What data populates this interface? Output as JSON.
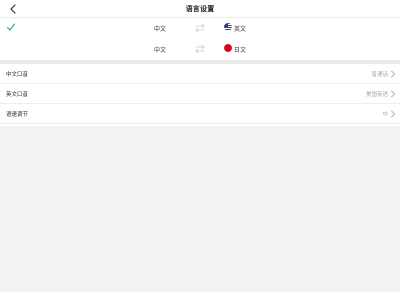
{
  "header": {
    "title": "语言设置",
    "back_icon": "chevron-left-icon"
  },
  "language_pairs": [
    {
      "source": "中文",
      "target": "英文",
      "target_flag": "us-flag-icon",
      "selected": true
    },
    {
      "source": "中文",
      "target": "日文",
      "target_flag": "jp-flag-icon",
      "selected": false
    }
  ],
  "settings": [
    {
      "label": "中文口音",
      "value": "普通话"
    },
    {
      "label": "英文口音",
      "value": "美国英语"
    },
    {
      "label": "语速调节",
      "value": "中"
    }
  ],
  "colors": {
    "accent": "#2bb673",
    "page_bg": "#f2f2f2",
    "panel_bg": "#ffffff",
    "muted_text": "#a6a6a6"
  }
}
